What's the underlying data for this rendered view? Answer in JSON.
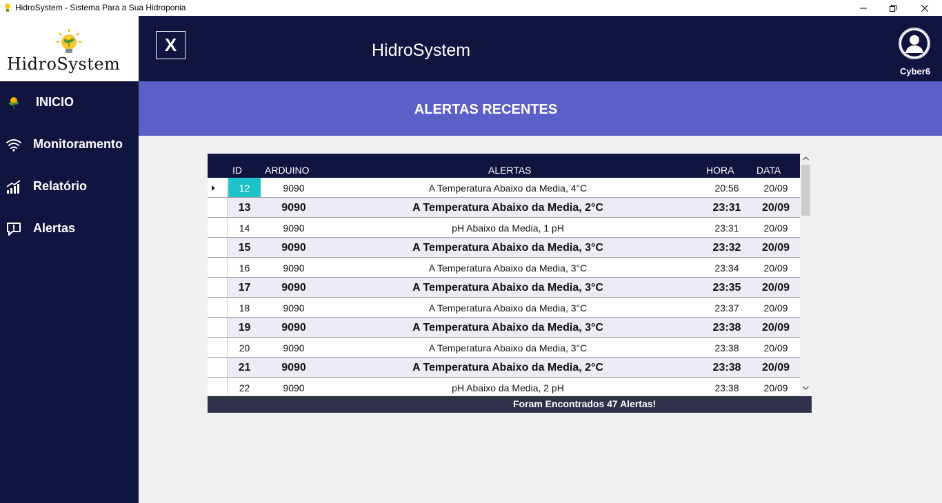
{
  "window": {
    "title": "HidroSystem - Sistema Para a Sua Hidroponia"
  },
  "logo": {
    "text": "HidroSystem"
  },
  "sidebar": {
    "items": [
      {
        "label": "INICIO",
        "icon": "plant-icon"
      },
      {
        "label": "Monitoramento",
        "icon": "wifi-icon"
      },
      {
        "label": "Relatório",
        "icon": "chart-icon"
      },
      {
        "label": "Alertas",
        "icon": "alert-bubble-icon"
      }
    ]
  },
  "header": {
    "close_label": "X",
    "title": "HidroSystem",
    "username": "Cyber6"
  },
  "banner": {
    "title": "ALERTAS RECENTES"
  },
  "table": {
    "columns": {
      "id": "ID",
      "arduino": "ARDUINO",
      "alertas": "ALERTAS",
      "hora": "HORA",
      "data": "DATA"
    },
    "rows": [
      {
        "id": "12",
        "arduino": "9090",
        "alerta": "A Temperatura Abaixo da Media, 4°C",
        "hora": "20:56",
        "data": "20/09"
      },
      {
        "id": "13",
        "arduino": "9090",
        "alerta": "A Temperatura Abaixo da Media, 2°C",
        "hora": "23:31",
        "data": "20/09"
      },
      {
        "id": "14",
        "arduino": "9090",
        "alerta": "pH  Abaixo da Media, 1 pH",
        "hora": "23:31",
        "data": "20/09"
      },
      {
        "id": "15",
        "arduino": "9090",
        "alerta": "A Temperatura Abaixo da Media, 3°C",
        "hora": "23:32",
        "data": "20/09"
      },
      {
        "id": "16",
        "arduino": "9090",
        "alerta": "A Temperatura Abaixo da Media, 3°C",
        "hora": "23:34",
        "data": "20/09"
      },
      {
        "id": "17",
        "arduino": "9090",
        "alerta": "A Temperatura Abaixo da Media, 3°C",
        "hora": "23:35",
        "data": "20/09"
      },
      {
        "id": "18",
        "arduino": "9090",
        "alerta": "A Temperatura Abaixo da Media, 3°C",
        "hora": "23:37",
        "data": "20/09"
      },
      {
        "id": "19",
        "arduino": "9090",
        "alerta": "A Temperatura Abaixo da Media, 3°C",
        "hora": "23:38",
        "data": "20/09"
      },
      {
        "id": "20",
        "arduino": "9090",
        "alerta": "A Temperatura Abaixo da Media, 3°C",
        "hora": "23:38",
        "data": "20/09"
      },
      {
        "id": "21",
        "arduino": "9090",
        "alerta": "A Temperatura Abaixo da Media, 2°C",
        "hora": "23:38",
        "data": "20/09"
      },
      {
        "id": "22",
        "arduino": "9090",
        "alerta": "pH  Abaixo da Media, 2 pH",
        "hora": "23:38",
        "data": "20/09"
      }
    ]
  },
  "footer": {
    "text": "Foram Encontrados 47 Alertas!"
  },
  "colors": {
    "navy": "#10153f",
    "banner": "#5b5fc7",
    "selected_cell": "#1ec3c9",
    "footer_bar": "#2e3148"
  }
}
